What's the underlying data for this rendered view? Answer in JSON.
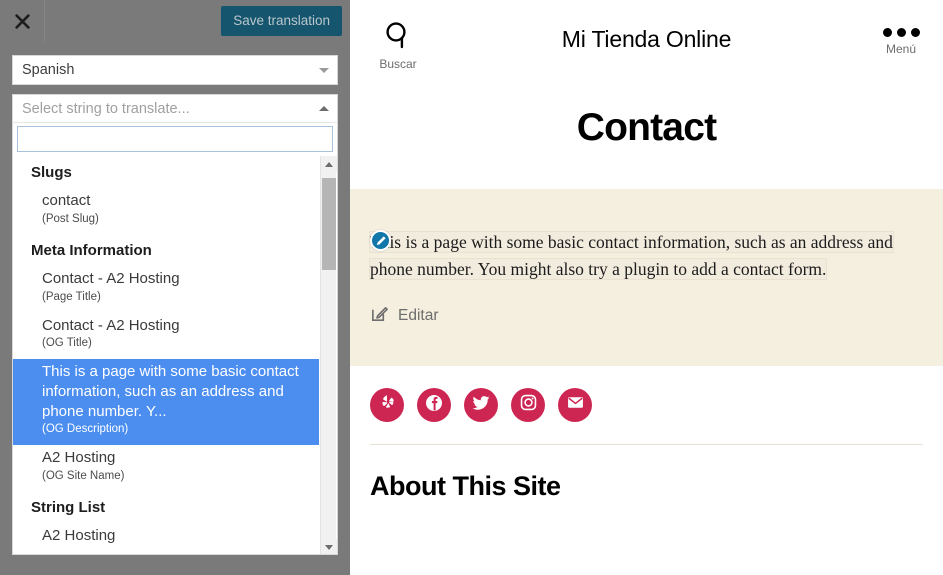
{
  "translator": {
    "close_label": "×",
    "save_label": "Save translation",
    "language": {
      "selected": "Spanish",
      "options": [
        "Spanish"
      ]
    },
    "string_selector": {
      "placeholder": "Select string to translate...",
      "search_value": "",
      "search_placeholder": ""
    },
    "groups": [
      {
        "label": "Slugs",
        "options": [
          {
            "text": "contact",
            "type": "(Post Slug)",
            "selected": false
          }
        ]
      },
      {
        "label": "Meta Information",
        "options": [
          {
            "text": "Contact - A2 Hosting",
            "type": "(Page Title)",
            "selected": false
          },
          {
            "text": "Contact - A2 Hosting",
            "type": "(OG Title)",
            "selected": false
          },
          {
            "text": "This is a page with some basic contact information, such as an address and phone number. Y...",
            "type": "(OG Description)",
            "selected": true
          },
          {
            "text": "A2 Hosting",
            "type": "(OG Site Name)",
            "selected": false
          }
        ]
      },
      {
        "label": "String List",
        "options": [
          {
            "text": "A2 Hosting",
            "type": "",
            "selected": false
          }
        ]
      }
    ]
  },
  "site": {
    "header": {
      "search_label": "Buscar",
      "title": "Mi Tienda Online",
      "menu_label": "Menú"
    },
    "page_title": "Contact",
    "content": {
      "paragraph": "This is a page with some basic contact information, such as an address and phone number. You might also try a plugin to add a contact form.",
      "edit_label": "Editar"
    },
    "social": [
      {
        "name": "yelp-icon",
        "label": "Yelp"
      },
      {
        "name": "facebook-icon",
        "label": "Facebook"
      },
      {
        "name": "twitter-icon",
        "label": "Twitter"
      },
      {
        "name": "instagram-icon",
        "label": "Instagram"
      },
      {
        "name": "email-icon",
        "label": "Email"
      }
    ],
    "about_title": "About This Site"
  },
  "colors": {
    "panel_gray": "#7a7a7a",
    "save_button": "#15556e",
    "selection_blue": "#4c8ef0",
    "content_beige": "#f5efe0",
    "social_accent": "#cd2653",
    "edit_badge_blue": "#1176a8"
  }
}
